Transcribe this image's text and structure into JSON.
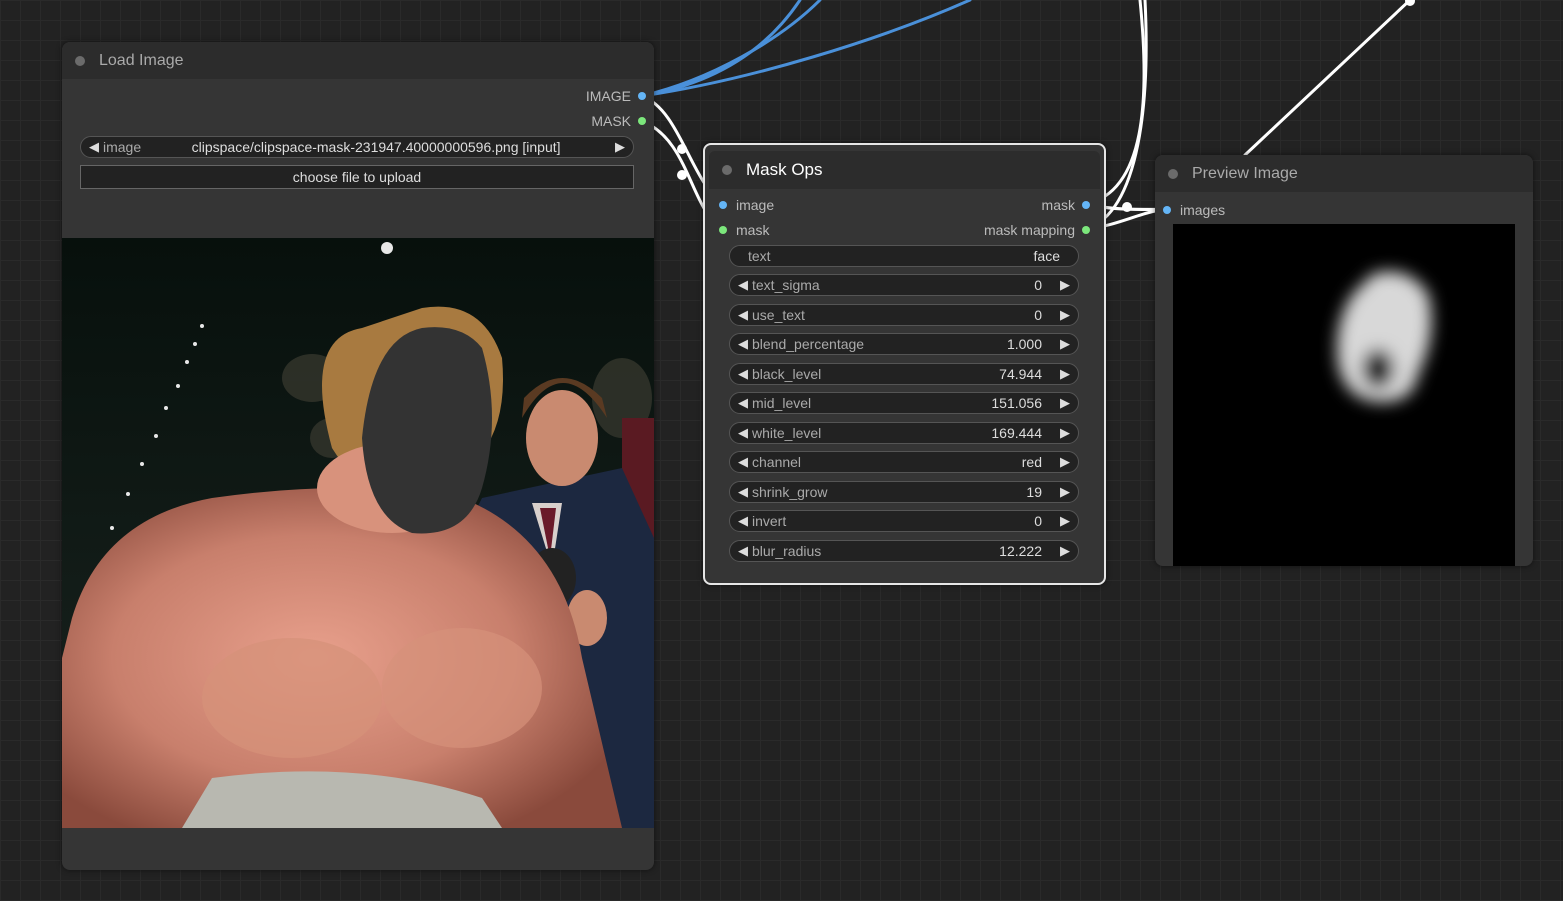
{
  "load_image": {
    "title": "Load Image",
    "outputs": [
      "IMAGE",
      "MASK"
    ],
    "image_widget": {
      "label": "image",
      "value": "clipspace/clipspace-mask-231947.40000000596.png [input]"
    },
    "upload_label": "choose file to upload"
  },
  "mask_ops": {
    "title": "Mask Ops",
    "inputs": [
      "image",
      "mask"
    ],
    "outputs": [
      "mask",
      "mask mapping"
    ],
    "text_widget": {
      "label": "text",
      "value": "face"
    },
    "widgets": [
      {
        "label": "text_sigma",
        "value": "0"
      },
      {
        "label": "use_text",
        "value": "0"
      },
      {
        "label": "blend_percentage",
        "value": "1.000"
      },
      {
        "label": "black_level",
        "value": "74.944"
      },
      {
        "label": "mid_level",
        "value": "151.056"
      },
      {
        "label": "white_level",
        "value": "169.444"
      },
      {
        "label": "channel",
        "value": "red"
      },
      {
        "label": "shrink_grow",
        "value": "19"
      },
      {
        "label": "invert",
        "value": "0"
      },
      {
        "label": "blur_radius",
        "value": "12.222"
      }
    ]
  },
  "preview_image": {
    "title": "Preview Image",
    "inputs": [
      "images"
    ]
  },
  "colors": {
    "canvas_bg": "#222222",
    "node_bg": "#353535",
    "image_link": "#4a90d9",
    "mask_link": "#ffffff",
    "image_slot": "#64b5f6",
    "mask_slot": "#7ce77c"
  }
}
